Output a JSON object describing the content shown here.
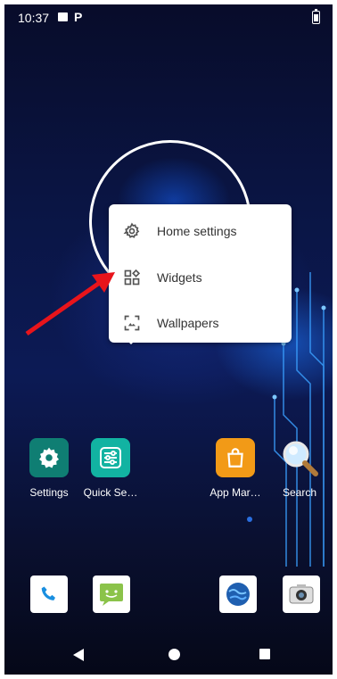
{
  "status_bar": {
    "time": "10:37",
    "icons": [
      "image-icon",
      "parking-icon",
      "battery-icon"
    ]
  },
  "context_menu": {
    "items": [
      {
        "label": "Home settings",
        "icon": "gear-icon"
      },
      {
        "label": "Widgets",
        "icon": "widgets-icon"
      },
      {
        "label": "Wallpapers",
        "icon": "wallpaper-icon"
      }
    ]
  },
  "apps": [
    {
      "label": "Settings",
      "icon": "settings-gear-icon",
      "color": "#0f7e73"
    },
    {
      "label": "Quick Se…",
      "icon": "sliders-icon",
      "color": "#12b3a2"
    },
    {
      "label": "App Mar…",
      "icon": "shopping-bag-icon",
      "color": "#f29a17"
    },
    {
      "label": "Search",
      "icon": "magnifier-icon",
      "color": "#9fd4f5"
    }
  ],
  "dock": [
    "phone-icon",
    "messaging-icon",
    "browser-icon",
    "camera-icon"
  ],
  "annotation": {
    "arrow_color": "#e8141b"
  }
}
